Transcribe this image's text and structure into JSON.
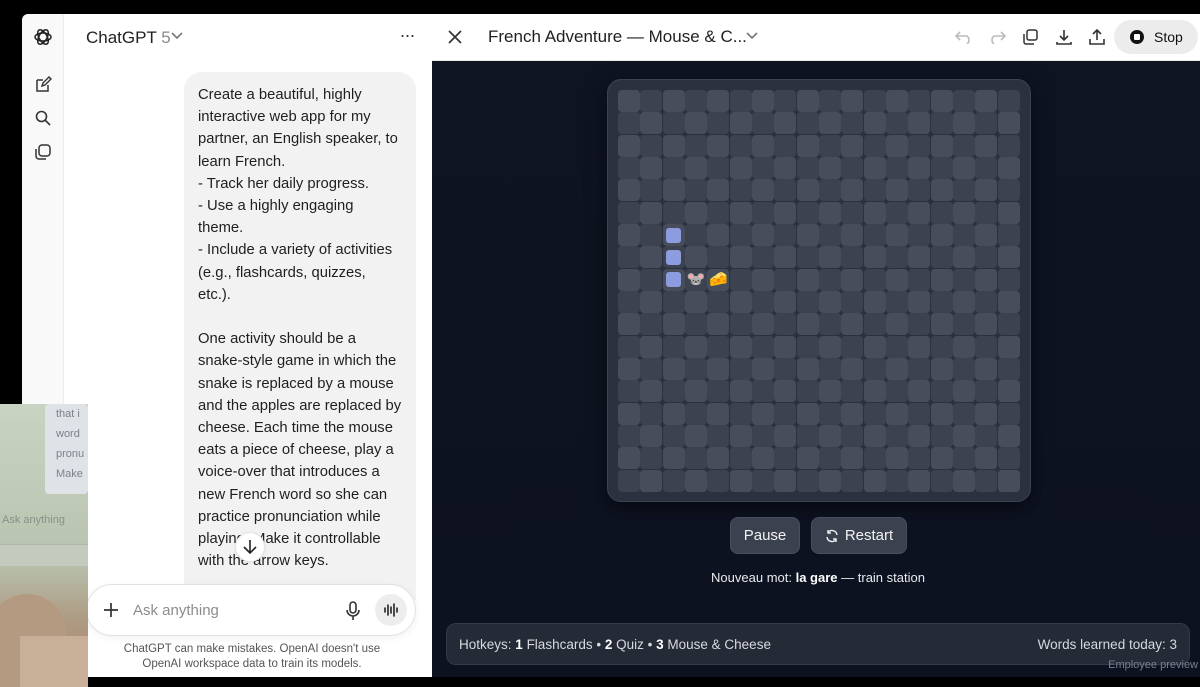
{
  "rail": {
    "icons": [
      "openai-logo-icon",
      "new-chat-icon",
      "search-icon",
      "library-icon"
    ]
  },
  "chat": {
    "model_name": "ChatGPT",
    "model_version": "5",
    "more_label": "···",
    "message": "Create a beautiful, highly interactive web app for my partner, an English speaker, to learn French.\n- Track her daily progress.\n- Use a highly engaging theme.\n- Include a variety of activities (e.g., flashcards, quizzes, etc.).\n\nOne activity should be a snake-style game in which the snake is replaced by a mouse and the apples are replaced by cheese. Each time the mouse eats a piece of cheese, play a voice-over that introduces a new French word so she can practice pronunciation while playing. Make it controllable with the arrow keys.",
    "composer_placeholder": "Ask anything",
    "disclaimer": "ChatGPT can make mistakes. OpenAI doesn't use OpenAI workspace data to train its models."
  },
  "webcam": {
    "ghost_lines": [
      "that i",
      "word",
      "pronu",
      "Make"
    ],
    "ghost_ask": "Ask anything"
  },
  "artifact": {
    "title": "French Adventure — Mouse & C...",
    "stop_label": "Stop",
    "header_icons": [
      "undo-icon",
      "redo-icon",
      "copy-icon",
      "download-icon",
      "share-icon"
    ],
    "game": {
      "grid_size": 18,
      "snake_cells": [
        [
          2,
          6
        ],
        [
          2,
          7
        ],
        [
          2,
          8
        ]
      ],
      "mouse_cell": [
        3,
        8
      ],
      "cheese_cell": [
        4,
        8
      ],
      "mouse_glyph": "🐭",
      "cheese_glyph": "🧀"
    },
    "controls": {
      "pause_label": "Pause",
      "restart_label": "Restart"
    },
    "word": {
      "prefix": "Nouveau mot: ",
      "french": "la gare",
      "separator": " — ",
      "english": "train station"
    },
    "footer": {
      "hotkeys_prefix": "Hotkeys: ",
      "hotkeys": [
        {
          "key": "1",
          "label": "Flashcards"
        },
        {
          "key": "2",
          "label": "Quiz"
        },
        {
          "key": "3",
          "label": "Mouse & Cheese"
        }
      ],
      "learned_label": "Words learned today: ",
      "learned_count": "3"
    },
    "preview_tag": "Employee preview"
  }
}
